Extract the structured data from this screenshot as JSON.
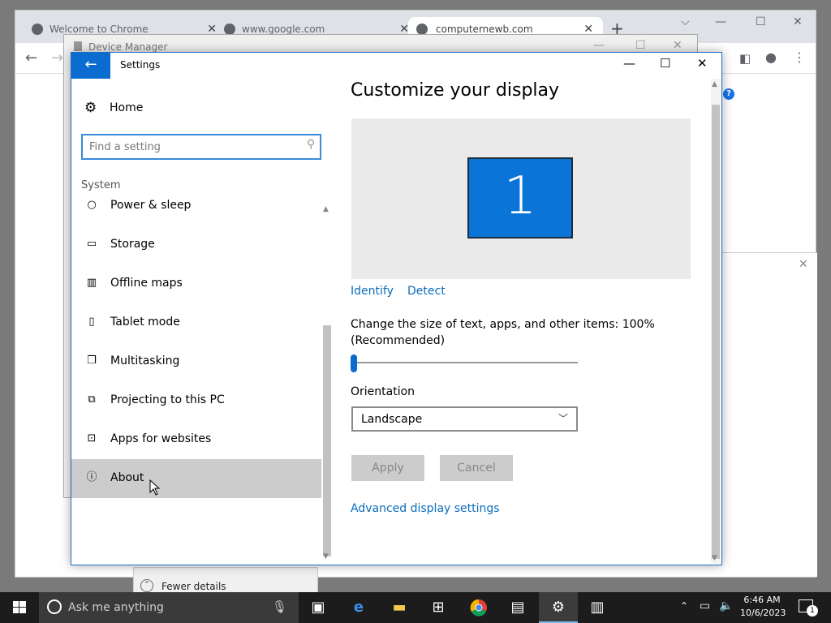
{
  "chrome": {
    "tabs": [
      {
        "label": "Welcome to Chrome"
      },
      {
        "label": "www.google.com"
      },
      {
        "label": "computernewb.com"
      }
    ]
  },
  "device_manager": {
    "title": "Device Manager"
  },
  "task_manager": {
    "fewer_details": "Fewer details"
  },
  "settings": {
    "title": "Settings",
    "home_label": "Home",
    "search_placeholder": "Find a setting",
    "section": "System",
    "nav_items": [
      {
        "label": "Power & sleep",
        "icon": "power-icon"
      },
      {
        "label": "Storage",
        "icon": "storage-icon"
      },
      {
        "label": "Offline maps",
        "icon": "map-icon"
      },
      {
        "label": "Tablet mode",
        "icon": "tablet-icon"
      },
      {
        "label": "Multitasking",
        "icon": "multitasking-icon"
      },
      {
        "label": "Projecting to this PC",
        "icon": "projecting-icon"
      },
      {
        "label": "Apps for websites",
        "icon": "apps-websites-icon"
      },
      {
        "label": "About",
        "icon": "info-icon"
      }
    ],
    "page_title": "Customize your display",
    "monitor_number": "1",
    "identify_label": "Identify",
    "detect_label": "Detect",
    "scale_text": "Change the size of text, apps, and other items: 100% (Recommended)",
    "scale_percent": 100,
    "orientation_label": "Orientation",
    "orientation_value": "Landscape",
    "apply_label": "Apply",
    "cancel_label": "Cancel",
    "advanced_label": "Advanced display settings",
    "accent_color": "#0a6ccf"
  },
  "taskbar": {
    "search_placeholder": "Ask me anything",
    "time": "6:46 AM",
    "date": "10/6/2023",
    "notification_count": "1"
  }
}
